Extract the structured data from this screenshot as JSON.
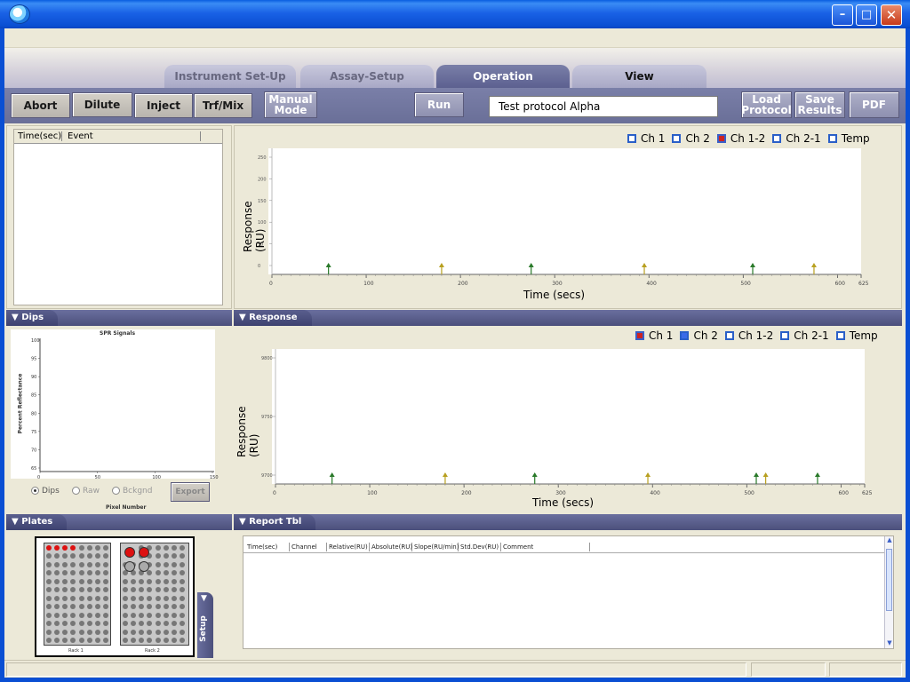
{
  "window": {
    "min": "–",
    "max": "□",
    "close": "✕"
  },
  "tabs": [
    "Instrument Set-Up",
    "Assay-Setup",
    "Operation",
    "View"
  ],
  "toolbar": {
    "abort": "Abort",
    "dilute": "Dilute",
    "inject": "Inject",
    "trf_mix": "Trf/Mix",
    "manual_1": "Manual",
    "manual_2": "Mode",
    "run": "Run",
    "protocol_value": "Test protocol Alpha",
    "load_1": "Load",
    "load_2": "Protocol",
    "save_1": "Save",
    "save_2": "Results",
    "pdf": "PDF"
  },
  "event_table": {
    "col_time": "Time(sec)",
    "col_event": "Event"
  },
  "top_chart": {
    "legend": [
      "Ch 1",
      "Ch 2",
      "Ch 1-2",
      "Ch 2-1",
      "Temp"
    ],
    "ylabel": "Response (RU)",
    "xlabel": "Time (secs)",
    "yticks": [
      "250",
      "200",
      "150",
      "100",
      "50",
      "0"
    ],
    "xticks": [
      "0",
      "100",
      "200",
      "300",
      "400",
      "500",
      "600",
      "625"
    ]
  },
  "dips": {
    "header": "Dips",
    "title": "SPR Signals",
    "ylabel": "Percent Reflectance",
    "xlabel": "Pixel Number",
    "yticks": [
      "100",
      "95",
      "90",
      "85",
      "80",
      "75",
      "70",
      "65"
    ],
    "xticks": [
      "0",
      "50",
      "100",
      "150"
    ],
    "radio_dips": "Dips",
    "radio_raw": "Raw",
    "radio_bckgnd": "Bckgnd",
    "export": "Export"
  },
  "response": {
    "header": "Response",
    "legend": [
      "Ch 1",
      "Ch 2",
      "Ch 1-2",
      "Ch 2-1",
      "Temp"
    ],
    "ylabel": "Response (RU)",
    "xlabel": "Time (secs)",
    "yticks": [
      "9800",
      "9750",
      "9700"
    ],
    "xticks": [
      "0",
      "100",
      "200",
      "300",
      "400",
      "500",
      "600",
      "625"
    ]
  },
  "plates": {
    "header": "Plates",
    "rack1": "Rack 1",
    "rack2": "Rack 2",
    "setup": "Setup"
  },
  "report": {
    "header": "Report Tbl",
    "columns": [
      "Time(sec)",
      "Channel",
      "Relative(RU)",
      "Absolute(RU)",
      "Slope(RU/min)",
      "Std.Dev(RU)",
      "Comment"
    ]
  },
  "colors": {
    "accent": "#5c6090",
    "red_well": "#dd1111",
    "arrow_green": "#2a7a2a",
    "arrow_yellow": "#b8a020"
  },
  "chart_data": [
    {
      "type": "line",
      "title": "",
      "xlabel": "Time (secs)",
      "ylabel": "Response (RU)",
      "xlim": [
        0,
        625
      ],
      "ylim": [
        0,
        250
      ],
      "series": [],
      "injection_markers": [
        60,
        180,
        275,
        395,
        510,
        575
      ]
    },
    {
      "type": "line",
      "title": "SPR Signals",
      "xlabel": "Pixel Number",
      "ylabel": "Percent Reflectance",
      "xlim": [
        0,
        150
      ],
      "ylim": [
        65,
        100
      ],
      "series": []
    },
    {
      "type": "line",
      "title": "",
      "xlabel": "Time (secs)",
      "ylabel": "Response (RU)",
      "xlim": [
        0,
        625
      ],
      "ylim": [
        9700,
        9800
      ],
      "series": [],
      "injection_markers": [
        60,
        180,
        275,
        395,
        510,
        520,
        575
      ]
    }
  ]
}
